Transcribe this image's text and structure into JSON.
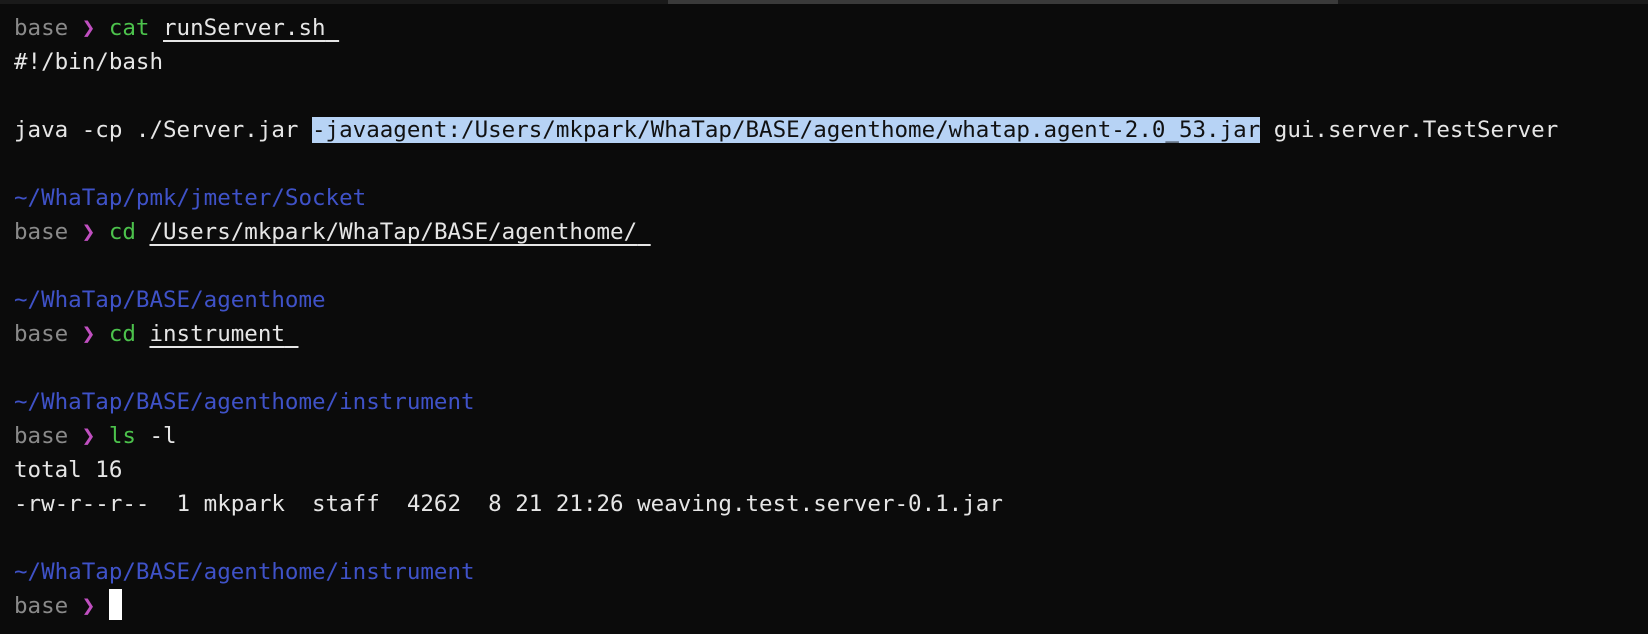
{
  "terminal": {
    "prompt_env": "base",
    "prompt_arrow": "❯",
    "blocks": [
      {
        "cmd": "cat",
        "arg": "runServer.sh",
        "output": [
          "#!/bin/bash",
          "",
          "java -cp ./Server.jar ",
          "-javaagent:/Users/mkpark/WhaTap/BASE/agenthome/whatap.agent-2.0_53.jar",
          " gui.server.TestServer"
        ]
      }
    ],
    "cat_cmd": "cat",
    "cat_arg": "runServer.sh",
    "shebang": "#!/bin/bash",
    "java_prefix": "java -cp ./Server.jar ",
    "java_highlight": "-javaagent:/Users/mkpark/WhaTap/BASE/agenthome/whatap.agent-2.0_53.jar",
    "java_suffix": " gui.server.TestServer",
    "dir1": "~/WhaTap/pmk/jmeter/Socket",
    "cd1_cmd": "cd",
    "cd1_arg": "/Users/mkpark/WhaTap/BASE/agenthome/",
    "dir2": "~/WhaTap/BASE/agenthome",
    "cd2_cmd": "cd",
    "cd2_arg": "instrument",
    "dir3": "~/WhaTap/BASE/agenthome/instrument",
    "ls_cmd": "ls",
    "ls_arg": "-l",
    "ls_total": "total 16",
    "ls_entry": "-rw-r--r--  1 mkpark  staff  4262  8 21 21:26 weaving.test.server-0.1.jar",
    "dir4": "~/WhaTap/BASE/agenthome/instrument"
  },
  "colors": {
    "background": "#0b0b0b",
    "text": "#e6e6e6",
    "prompt_env": "#8a8a8a",
    "prompt_arrow": "#c04fc0",
    "command": "#4cc24c",
    "path": "#3f52c8",
    "selection": "#b7d3f5"
  }
}
